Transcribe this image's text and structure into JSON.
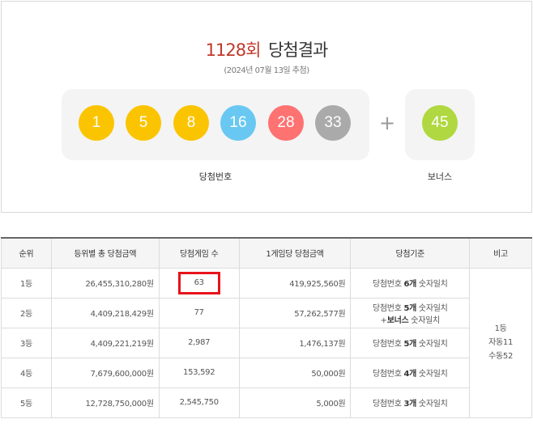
{
  "header": {
    "round": "1128회",
    "title_suffix": "당첨결과",
    "draw_date": "(2024년 07월 13일 추첨)"
  },
  "winning_numbers": {
    "balls": [
      {
        "value": "1",
        "color": "#fbc400"
      },
      {
        "value": "5",
        "color": "#fbc400"
      },
      {
        "value": "8",
        "color": "#fbc400"
      },
      {
        "value": "16",
        "color": "#69c8f2"
      },
      {
        "value": "28",
        "color": "#ff7272"
      },
      {
        "value": "33",
        "color": "#aaaaaa"
      }
    ],
    "plus_symbol": "+",
    "bonus": {
      "value": "45",
      "color": "#b0d840"
    },
    "caption": "당첨번호",
    "bonus_caption": "보너스"
  },
  "table": {
    "headers": [
      "순위",
      "등위별 총 당첨금액",
      "당첨게임 수",
      "1게임당 당첨금액",
      "당첨기준",
      "비고"
    ],
    "rows": [
      {
        "rank": "1등",
        "total": "26,455,310,280원",
        "games": "63",
        "per_game": "419,925,560원",
        "crit_pre": "당첨번호 ",
        "crit_bold": "6개",
        "crit_post": " 숫자일치",
        "crit_line2": ""
      },
      {
        "rank": "2등",
        "total": "4,409,218,429원",
        "games": "77",
        "per_game": "57,262,577원",
        "crit_pre": "당첨번호 ",
        "crit_bold": "5개",
        "crit_post": " 숫자일치",
        "crit_line2_pre": "+",
        "crit_line2_bold": "보너스",
        "crit_line2_post": " 숫자일치"
      },
      {
        "rank": "3등",
        "total": "4,409,221,219원",
        "games": "2,987",
        "per_game": "1,476,137원",
        "crit_pre": "당첨번호 ",
        "crit_bold": "5개",
        "crit_post": " 숫자일치"
      },
      {
        "rank": "4등",
        "total": "7,679,600,000원",
        "games": "153,592",
        "per_game": "50,000원",
        "crit_pre": "당첨번호 ",
        "crit_bold": "4개",
        "crit_post": " 숫자일치"
      },
      {
        "rank": "5등",
        "total": "12,728,750,000원",
        "games": "2,545,750",
        "per_game": "5,000원",
        "crit_pre": "당첨번호 ",
        "crit_bold": "3개",
        "crit_post": " 숫자일치"
      }
    ],
    "note": {
      "line1": "1등",
      "line2": "자동11",
      "line3": "수동52"
    },
    "highlight_color": "#e8131a"
  }
}
